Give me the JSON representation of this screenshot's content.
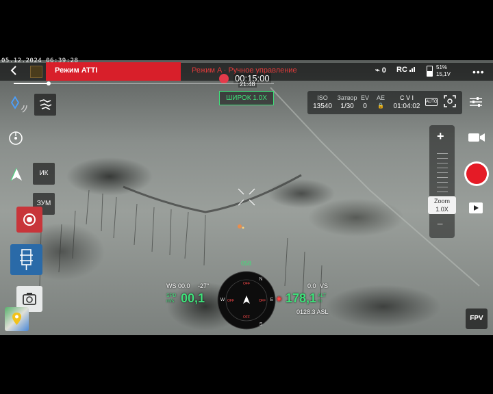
{
  "timestamp": "05.12.2024 06:39:28",
  "topbar": {
    "mode_label": "Режим ATTI",
    "mode_sub": "Режим A · Ручное управление",
    "rec_time": "00:15:00",
    "rec_sub": "21:48",
    "gps_count": "0",
    "rc_label": "RC",
    "battery_percent": "51%",
    "battery_voltage": "15,1V",
    "battery_level": 0.51,
    "menu": "•••"
  },
  "zoom_chip": "ШИРОК   1.0X",
  "camera": {
    "iso_label": "ISO",
    "iso_value": "13540",
    "shutter_label": "Затвор",
    "shutter_value": "1/30",
    "ev_label": "EV",
    "ev_value": "0",
    "ae_label": "AE",
    "ae_value": "🔒",
    "storage_label": "C V I",
    "storage_value": "01:04:02",
    "auto_label": "AUTO"
  },
  "left_panel": {
    "ir_label": "ИК",
    "zoom_label": "ЗУМ"
  },
  "zoom_panel": {
    "plus": "+",
    "minus": "−",
    "label": "Zoom",
    "value": "1.0X"
  },
  "fpv_label": "FPV",
  "telemetry": {
    "heading": "058",
    "ws_label": "WS 00.0",
    "ws_dir": "-27°",
    "spd_label_top": "SPD",
    "spd_label_bot": "m/s",
    "spd_value": "00,1",
    "alt_top": "0.0",
    "vs_label": "VS",
    "alt_value": "178,1",
    "alt_unit_top": "ALT",
    "alt_unit_bot": "m",
    "asl_value": "0128.3 ASL",
    "compass_n": "N",
    "compass_e": "E",
    "compass_s": "S",
    "compass_w": "W",
    "off_top": "OFF",
    "off_left": "OFF",
    "off_right": "OFF",
    "off_bottom": "OFF"
  },
  "colors": {
    "mode_red": "#d81f2a",
    "accent_green": "#3fe07a",
    "record_red": "#e51b26"
  }
}
